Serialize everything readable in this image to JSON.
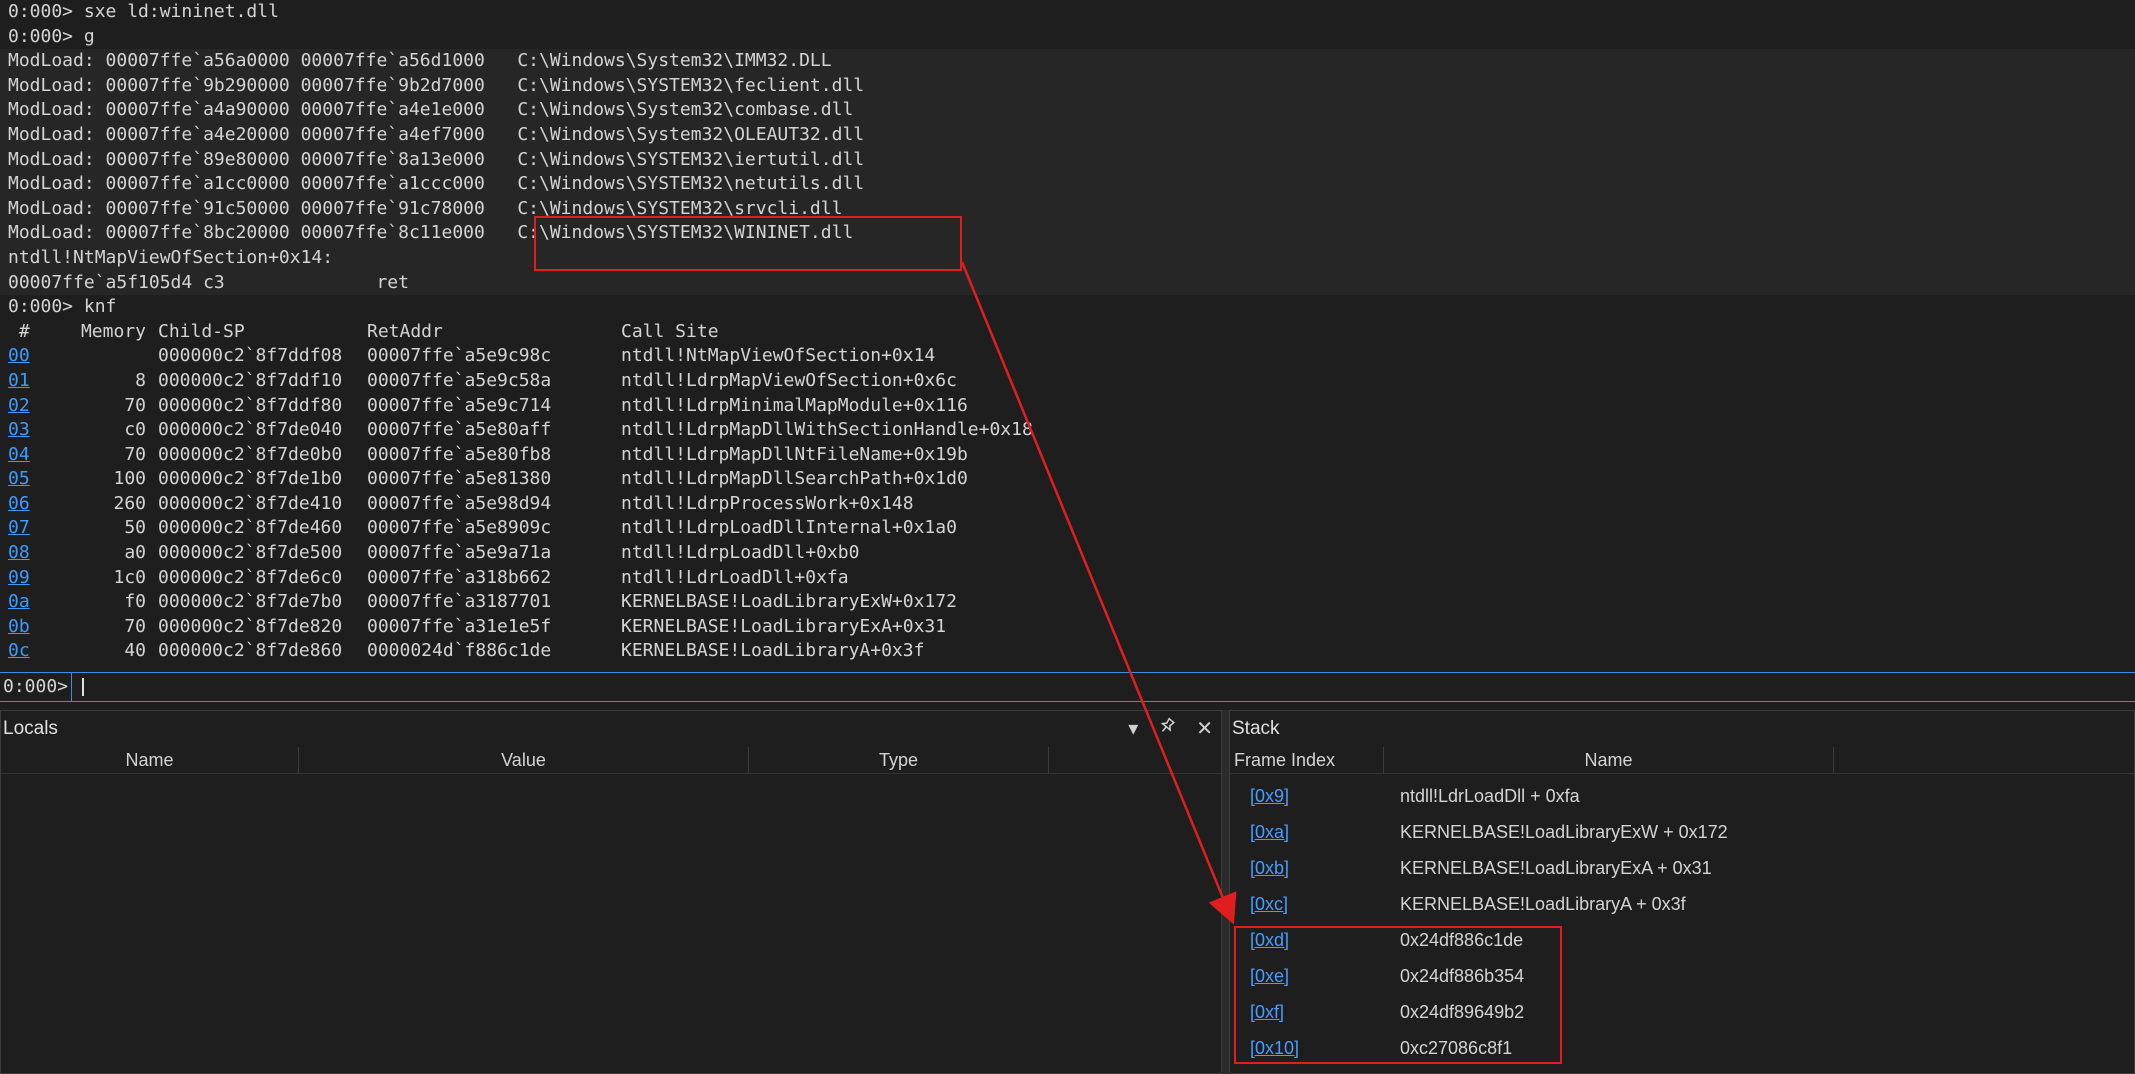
{
  "console": {
    "lines": [
      {
        "text": "0:000> sxe ld:wininet.dll",
        "shaded": false
      },
      {
        "text": "0:000> g",
        "shaded": false
      },
      {
        "text": "ModLoad: 00007ffe`a56a0000 00007ffe`a56d1000   C:\\Windows\\System32\\IMM32.DLL",
        "shaded": true
      },
      {
        "text": "ModLoad: 00007ffe`9b290000 00007ffe`9b2d7000   C:\\Windows\\SYSTEM32\\feclient.dll",
        "shaded": true
      },
      {
        "text": "ModLoad: 00007ffe`a4a90000 00007ffe`a4e1e000   C:\\Windows\\System32\\combase.dll",
        "shaded": true
      },
      {
        "text": "ModLoad: 00007ffe`a4e20000 00007ffe`a4ef7000   C:\\Windows\\System32\\OLEAUT32.dll",
        "shaded": true
      },
      {
        "text": "ModLoad: 00007ffe`89e80000 00007ffe`8a13e000   C:\\Windows\\SYSTEM32\\iertutil.dll",
        "shaded": true
      },
      {
        "text": "ModLoad: 00007ffe`a1cc0000 00007ffe`a1ccc000   C:\\Windows\\SYSTEM32\\netutils.dll",
        "shaded": true
      },
      {
        "text": "ModLoad: 00007ffe`91c50000 00007ffe`91c78000   C:\\Windows\\SYSTEM32\\srvcli.dll",
        "shaded": true
      },
      {
        "text": "ModLoad: 00007ffe`8bc20000 00007ffe`8c11e000   C:\\Windows\\SYSTEM32\\WININET.dll",
        "shaded": true
      },
      {
        "text": "ntdll!NtMapViewOfSection+0x14:",
        "shaded": true
      },
      {
        "text": "00007ffe`a5f105d4 c3              ret",
        "shaded": true
      },
      {
        "text": "0:000> knf",
        "shaded": false
      }
    ],
    "knf_header": {
      "idx": " #",
      "memory": "Memory",
      "child_sp": "Child-SP",
      "ret_addr": "RetAddr",
      "call_site": "Call Site"
    },
    "knf_rows": [
      {
        "idx": "00",
        "memory": "",
        "child_sp": "000000c2`8f7ddf08",
        "ret_addr": "00007ffe`a5e9c98c",
        "call_site": "ntdll!NtMapViewOfSection+0x14"
      },
      {
        "idx": "01",
        "memory": "8",
        "child_sp": "000000c2`8f7ddf10",
        "ret_addr": "00007ffe`a5e9c58a",
        "call_site": "ntdll!LdrpMapViewOfSection+0x6c"
      },
      {
        "idx": "02",
        "memory": "70",
        "child_sp": "000000c2`8f7ddf80",
        "ret_addr": "00007ffe`a5e9c714",
        "call_site": "ntdll!LdrpMinimalMapModule+0x116"
      },
      {
        "idx": "03",
        "memory": "c0",
        "child_sp": "000000c2`8f7de040",
        "ret_addr": "00007ffe`a5e80aff",
        "call_site": "ntdll!LdrpMapDllWithSectionHandle+0x18"
      },
      {
        "idx": "04",
        "memory": "70",
        "child_sp": "000000c2`8f7de0b0",
        "ret_addr": "00007ffe`a5e80fb8",
        "call_site": "ntdll!LdrpMapDllNtFileName+0x19b"
      },
      {
        "idx": "05",
        "memory": "100",
        "child_sp": "000000c2`8f7de1b0",
        "ret_addr": "00007ffe`a5e81380",
        "call_site": "ntdll!LdrpMapDllSearchPath+0x1d0"
      },
      {
        "idx": "06",
        "memory": "260",
        "child_sp": "000000c2`8f7de410",
        "ret_addr": "00007ffe`a5e98d94",
        "call_site": "ntdll!LdrpProcessWork+0x148"
      },
      {
        "idx": "07",
        "memory": "50",
        "child_sp": "000000c2`8f7de460",
        "ret_addr": "00007ffe`a5e8909c",
        "call_site": "ntdll!LdrpLoadDllInternal+0x1a0"
      },
      {
        "idx": "08",
        "memory": "a0",
        "child_sp": "000000c2`8f7de500",
        "ret_addr": "00007ffe`a5e9a71a",
        "call_site": "ntdll!LdrpLoadDll+0xb0"
      },
      {
        "idx": "09",
        "memory": "1c0",
        "child_sp": "000000c2`8f7de6c0",
        "ret_addr": "00007ffe`a318b662",
        "call_site": "ntdll!LdrLoadDll+0xfa"
      },
      {
        "idx": "0a",
        "memory": "f0",
        "child_sp": "000000c2`8f7de7b0",
        "ret_addr": "00007ffe`a3187701",
        "call_site": "KERNELBASE!LoadLibraryExW+0x172"
      },
      {
        "idx": "0b",
        "memory": "70",
        "child_sp": "000000c2`8f7de820",
        "ret_addr": "00007ffe`a31e1e5f",
        "call_site": "KERNELBASE!LoadLibraryExA+0x31"
      },
      {
        "idx": "0c",
        "memory": "40",
        "child_sp": "000000c2`8f7de860",
        "ret_addr": "0000024d`f886c1de",
        "call_site": "KERNELBASE!LoadLibraryA+0x3f"
      }
    ],
    "prompt": "0:000>"
  },
  "locals": {
    "title": "Locals",
    "columns": {
      "name": "Name",
      "value": "Value",
      "type": "Type"
    },
    "dropdown_icon": "▾",
    "pin_icon": "📌",
    "close_icon": "✕"
  },
  "stack": {
    "title": "Stack",
    "columns": {
      "frame_index": "Frame Index",
      "name": "Name"
    },
    "rows": [
      {
        "fi": "[0x9]",
        "name": "ntdll!LdrLoadDll + 0xfa"
      },
      {
        "fi": "[0xa]",
        "name": "KERNELBASE!LoadLibraryExW + 0x172"
      },
      {
        "fi": "[0xb]",
        "name": "KERNELBASE!LoadLibraryExA + 0x31"
      },
      {
        "fi": "[0xc]",
        "name": "KERNELBASE!LoadLibraryA + 0x3f"
      },
      {
        "fi": "[0xd]",
        "name": "0x24df886c1de"
      },
      {
        "fi": "[0xe]",
        "name": "0x24df886b354"
      },
      {
        "fi": "[0xf]",
        "name": "0x24df89649b2"
      },
      {
        "fi": "[0x10]",
        "name": "0xc27086c8f1"
      }
    ]
  },
  "colors": {
    "accent": "#3a8ee6",
    "highlight": "#e01e1e",
    "link": "#3b9cff",
    "background": "#1e1e1e"
  }
}
